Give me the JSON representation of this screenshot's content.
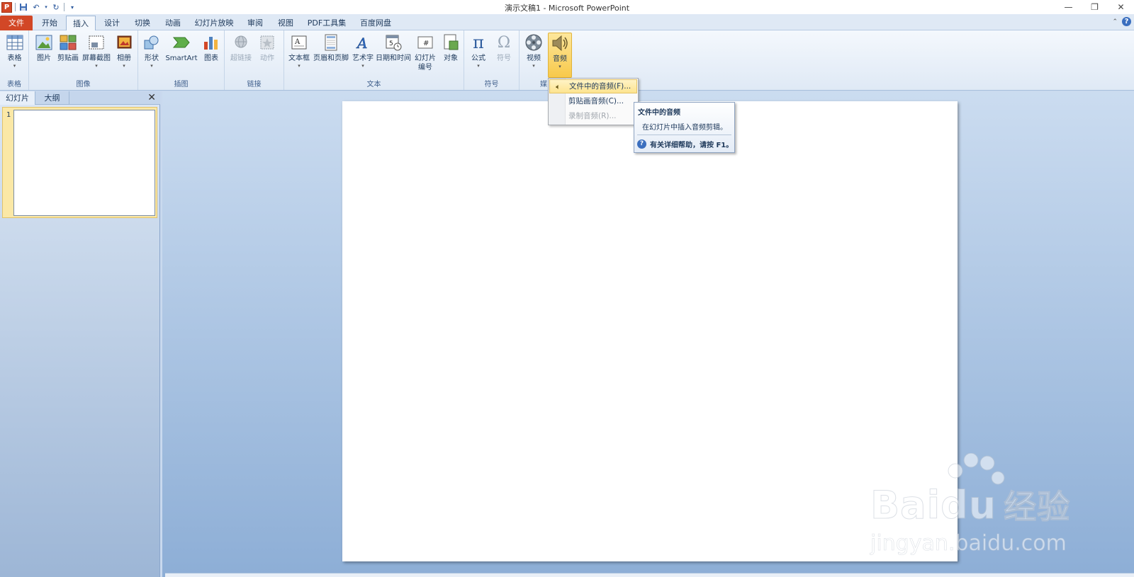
{
  "window": {
    "title": "演示文稿1 - Microsoft PowerPoint",
    "qat_logo": "P"
  },
  "tabs": [
    {
      "label": "文件"
    },
    {
      "label": "开始"
    },
    {
      "label": "插入"
    },
    {
      "label": "设计"
    },
    {
      "label": "切换"
    },
    {
      "label": "动画"
    },
    {
      "label": "幻灯片放映"
    },
    {
      "label": "审阅"
    },
    {
      "label": "视图"
    },
    {
      "label": "PDF工具集"
    },
    {
      "label": "百度网盘"
    }
  ],
  "active_tab": "插入",
  "ribbon": {
    "groups": {
      "table": "表格",
      "images": "图像",
      "illustrations": "插图",
      "links": "链接",
      "text": "文本",
      "symbols": "符号",
      "media": "媒"
    },
    "buttons": {
      "table": "表格",
      "picture": "图片",
      "clipart": "剪贴画",
      "screenshot": "屏幕截图",
      "album": "相册",
      "shapes": "形状",
      "smartart": "SmartArt",
      "chart": "图表",
      "hyperlink": "超链接",
      "action": "动作",
      "textbox": "文本框",
      "header_footer": "页眉和页脚",
      "wordart": "艺术字",
      "datetime": "日期和时间",
      "slide_number_1": "幻灯片",
      "slide_number_2": "编号",
      "object": "对象",
      "equation": "公式",
      "symbol": "符号",
      "video": "视频",
      "audio": "音频"
    }
  },
  "left_pane": {
    "tabs": [
      "幻灯片",
      "大纲"
    ],
    "slide_number": "1"
  },
  "audio_menu": {
    "items": [
      {
        "label": "文件中的音频(F)..."
      },
      {
        "label": "剪贴画音频(C)..."
      },
      {
        "label": "录制音频(R)..."
      }
    ]
  },
  "tooltip": {
    "title": "文件中的音频",
    "description": "在幻灯片中插入音频剪辑。",
    "help": "有关详细帮助，请按 F1。"
  },
  "watermark": {
    "brand": "Bai",
    "brand2": "du",
    "cn": "经验",
    "url": "jingyan.baidu.com"
  },
  "colors": {
    "file_tab": "#d24726",
    "accent_hot": "#f8c94a",
    "slide_bg": "#ffffff"
  }
}
